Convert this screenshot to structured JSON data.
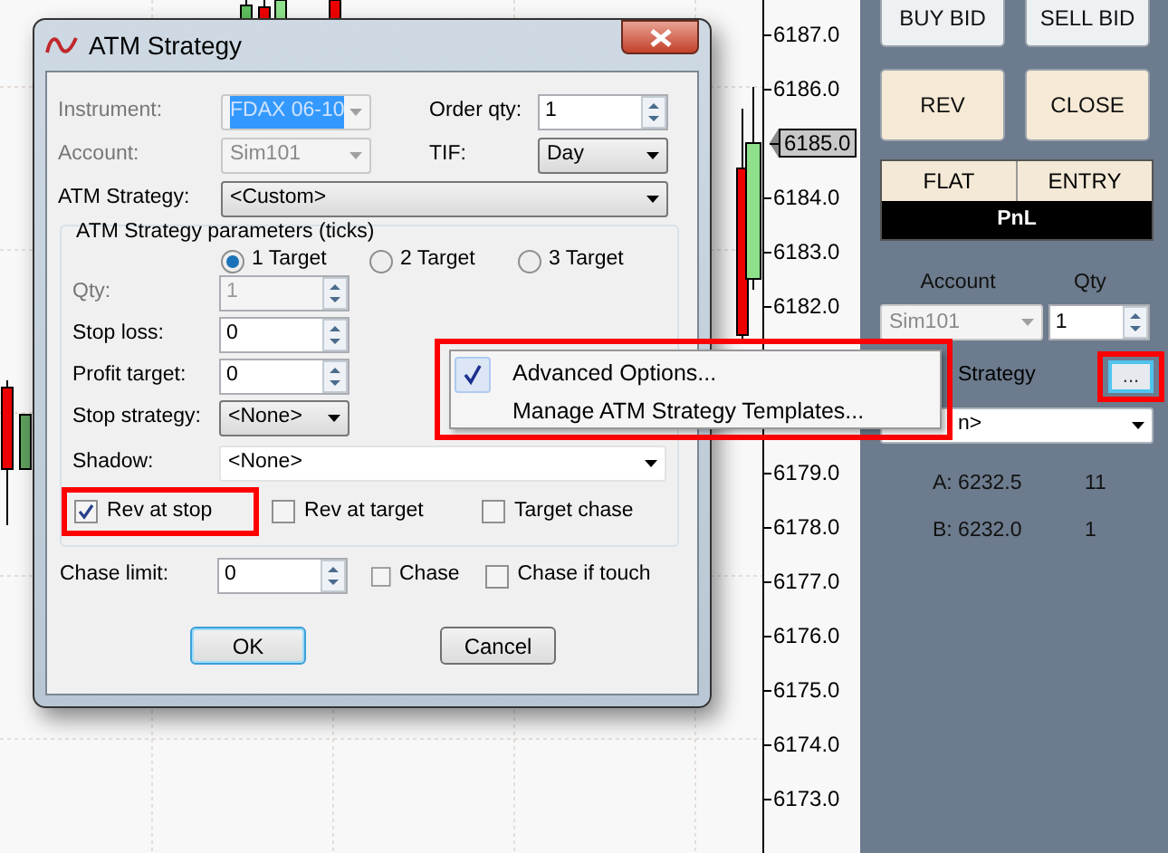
{
  "chart": {
    "price_labels_upper": [
      {
        "text": "6187.0",
        "current": false
      },
      {
        "text": "6186.0",
        "current": false
      },
      {
        "text": "6185.0",
        "current": true
      },
      {
        "text": "6184.0",
        "current": false
      },
      {
        "text": "6183.0",
        "current": false
      },
      {
        "text": "6182.0",
        "current": false
      }
    ],
    "price_labels_lower": [
      {
        "text": "6179.0",
        "current": false
      },
      {
        "text": "6178.0",
        "current": false
      },
      {
        "text": "6177.0",
        "current": false
      },
      {
        "text": "6176.0",
        "current": false
      },
      {
        "text": "6175.0",
        "current": false
      },
      {
        "text": "6174.0",
        "current": false
      },
      {
        "text": "6173.0",
        "current": false
      }
    ]
  },
  "right_panel": {
    "buttons": [
      {
        "label": "BUY BID",
        "kind": "plain"
      },
      {
        "label": "SELL BID",
        "kind": "plain"
      },
      {
        "label": "REV",
        "kind": "warm"
      },
      {
        "label": "CLOSE",
        "kind": "warm"
      }
    ],
    "position": {
      "flat": "FLAT",
      "entry": "ENTRY",
      "pnl": "PnL"
    },
    "account_label": "Account",
    "qty_label": "Qty",
    "account_value": "Sim101",
    "account_disabled": true,
    "qty_value": "1",
    "strategy_label": "Strategy",
    "more_button": "...",
    "strategy_value": "n>",
    "orders": [
      {
        "price": "A: 6232.5",
        "qty": "11"
      },
      {
        "price": "B: 6232.0",
        "qty": "1"
      }
    ]
  },
  "dialog": {
    "title": "ATM Strategy",
    "instrument": {
      "label": "Instrument:",
      "value": "FDAX 06-10",
      "disabled": true,
      "text_selected": true
    },
    "order_qty": {
      "label": "Order qty:",
      "value": "1"
    },
    "account": {
      "label": "Account:",
      "value": "Sim101",
      "disabled": true
    },
    "tif": {
      "label": "TIF:",
      "value": "Day"
    },
    "atm_strategy": {
      "label": "ATM Strategy:",
      "value": "<Custom>"
    },
    "group_title": "ATM Strategy parameters (ticks)",
    "targets": [
      {
        "label": "1 Target",
        "selected": true
      },
      {
        "label": "2 Target",
        "selected": false
      },
      {
        "label": "3 Target",
        "selected": false
      }
    ],
    "qty": {
      "label": "Qty:",
      "value": "1",
      "disabled": true
    },
    "stop_loss": {
      "label": "Stop loss:",
      "value": "0"
    },
    "profit_target": {
      "label": "Profit target:",
      "value": "0"
    },
    "stop_strategy": {
      "label": "Stop strategy:",
      "value": "<None>"
    },
    "shadow": {
      "label": "Shadow:",
      "value": "<None>"
    },
    "reverse_options": [
      {
        "label": "Rev at stop",
        "checked": true,
        "highlighted": true
      },
      {
        "label": "Rev at target",
        "checked": false,
        "highlighted": false
      },
      {
        "label": "Target chase",
        "checked": false,
        "highlighted": false
      }
    ],
    "chase_limit": {
      "label": "Chase limit:",
      "value": "0"
    },
    "chase_options": [
      {
        "label": "Chase",
        "checked": false
      },
      {
        "label": "Chase if touch",
        "checked": false
      }
    ],
    "ok_button": "OK",
    "cancel_button": "Cancel"
  },
  "context_menu": {
    "highlighted": true,
    "items": [
      {
        "label": "Advanced Options...",
        "checked": true
      },
      {
        "label": "Manage ATM Strategy Templates...",
        "checked": false
      }
    ]
  },
  "more_button_highlighted": true
}
